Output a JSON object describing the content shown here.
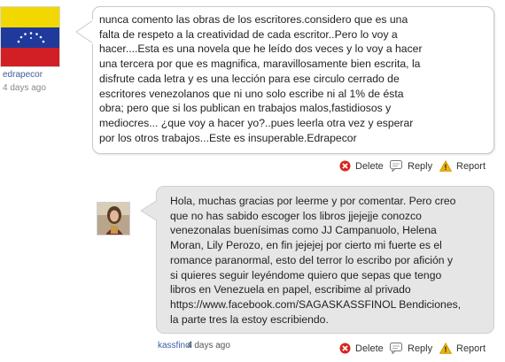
{
  "comment1": {
    "author": "edrapecor",
    "time": "4 days ago",
    "text": "nunca comento las obras de los escritores.considero que es una\nfalta de respeto a la creatividad de cada escritor..Pero lo voy a\nhacer....Esta es una novela que he leído dos veces y lo voy a hacer\nuna tercera por que es magnifica, maravillosamente bien escrita, la\ndisfrute cada letra y es una lección para ese circulo cerrado de\nescritores  venezolanos que ni uno solo escribe ni al 1% de  ésta\nobra; pero que si los publican en trabajos malos,fastidiosos y\nmediocres... ¿que voy a hacer yo?..pues leerla otra vez y esperar\npor los otros trabajos...Este es insuperable.Edrapecor",
    "avatar_icon": "venezuela-flag"
  },
  "comment2": {
    "author": "kassfinol",
    "time": "4 days ago",
    "text": "Hola, muchas gracias por leerme y por comentar. Pero creo\nque no has sabido escoger los libros jjejejje conozco\nvenezonalas buenísimas como JJ Campanuolo, Helena\nMoran, Lily Perozo, en fin jejejej por cierto mi fuerte es el\nromance paranormal, esto del terror lo escribo por afición y\nsi quieres seguir leyéndome quiero que sepas que tengo\nlibros en Venezuela en papel, escribime al privado\nhttps://www.facebook.com/SAGASKASSFINOL Bendiciones,\nla parte tres la estoy escribiendo.",
    "avatar_icon": "user-photo"
  },
  "actions": {
    "delete_label": "Delete",
    "reply_label": "Reply",
    "report_label": "Report"
  },
  "colors": {
    "link": "#3a5ea3",
    "delete": "#d9261c",
    "report": "#f0b400"
  }
}
